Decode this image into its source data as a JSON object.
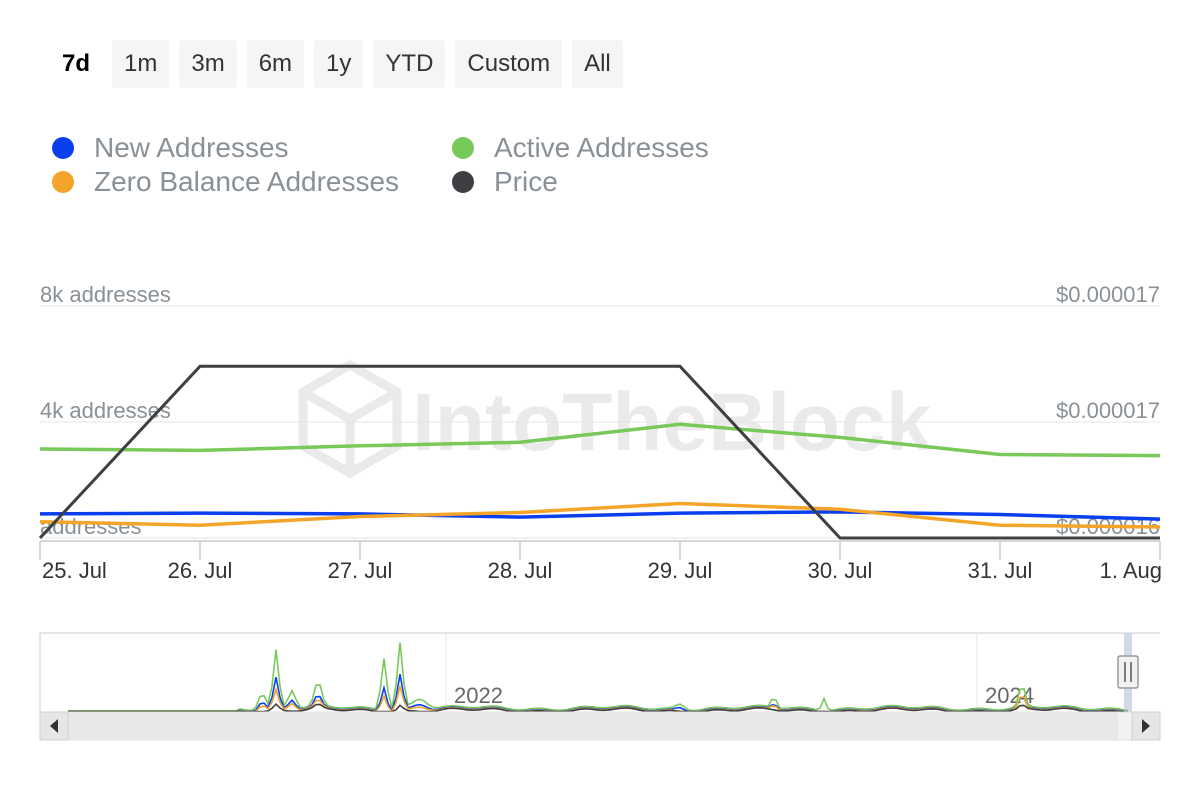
{
  "range_selector": {
    "buttons": [
      "7d",
      "1m",
      "3m",
      "6m",
      "1y",
      "YTD",
      "Custom",
      "All"
    ],
    "active": "7d"
  },
  "watermark": "IntoTheBlock",
  "colors": {
    "new_addresses": "#0a3ff0",
    "active_addresses": "#79c85a",
    "zero_balance": "#f5a42a",
    "price": "#3d3f42"
  },
  "chart_data": {
    "type": "line",
    "categories": [
      "25. Jul",
      "26. Jul",
      "27. Jul",
      "28. Jul",
      "29. Jul",
      "30. Jul",
      "31. Jul",
      "1. Aug"
    ],
    "y_left": {
      "ticks": [
        "8k addresses",
        "4k addresses",
        "addresses"
      ],
      "tick_values": [
        8000,
        4000,
        0
      ],
      "range": [
        0,
        8000
      ]
    },
    "y_right": {
      "ticks": [
        "$0.000017",
        "$0.000017",
        "$0.000016"
      ],
      "range": [
        1.62e-05,
        1.72e-05
      ]
    },
    "grid": true,
    "legend_placement": "top-left",
    "series": [
      {
        "name": "New Addresses",
        "axis": "left",
        "values": [
          830,
          860,
          830,
          720,
          860,
          900,
          810,
          650
        ]
      },
      {
        "name": "Active Addresses",
        "axis": "left",
        "values": [
          3070,
          3020,
          3180,
          3300,
          3920,
          3470,
          2880,
          2840
        ]
      },
      {
        "name": "Zero Balance Addresses",
        "axis": "left",
        "values": [
          560,
          440,
          740,
          880,
          1190,
          990,
          440,
          380
        ]
      },
      {
        "name": "Price",
        "axis": "right",
        "values": [
          1.62e-05,
          1.694e-05,
          1.694e-05,
          1.694e-05,
          1.694e-05,
          1.62e-05,
          1.62e-05,
          1.62e-05
        ]
      }
    ]
  },
  "navigator": {
    "year_labels": [
      "2022",
      "2024"
    ]
  }
}
